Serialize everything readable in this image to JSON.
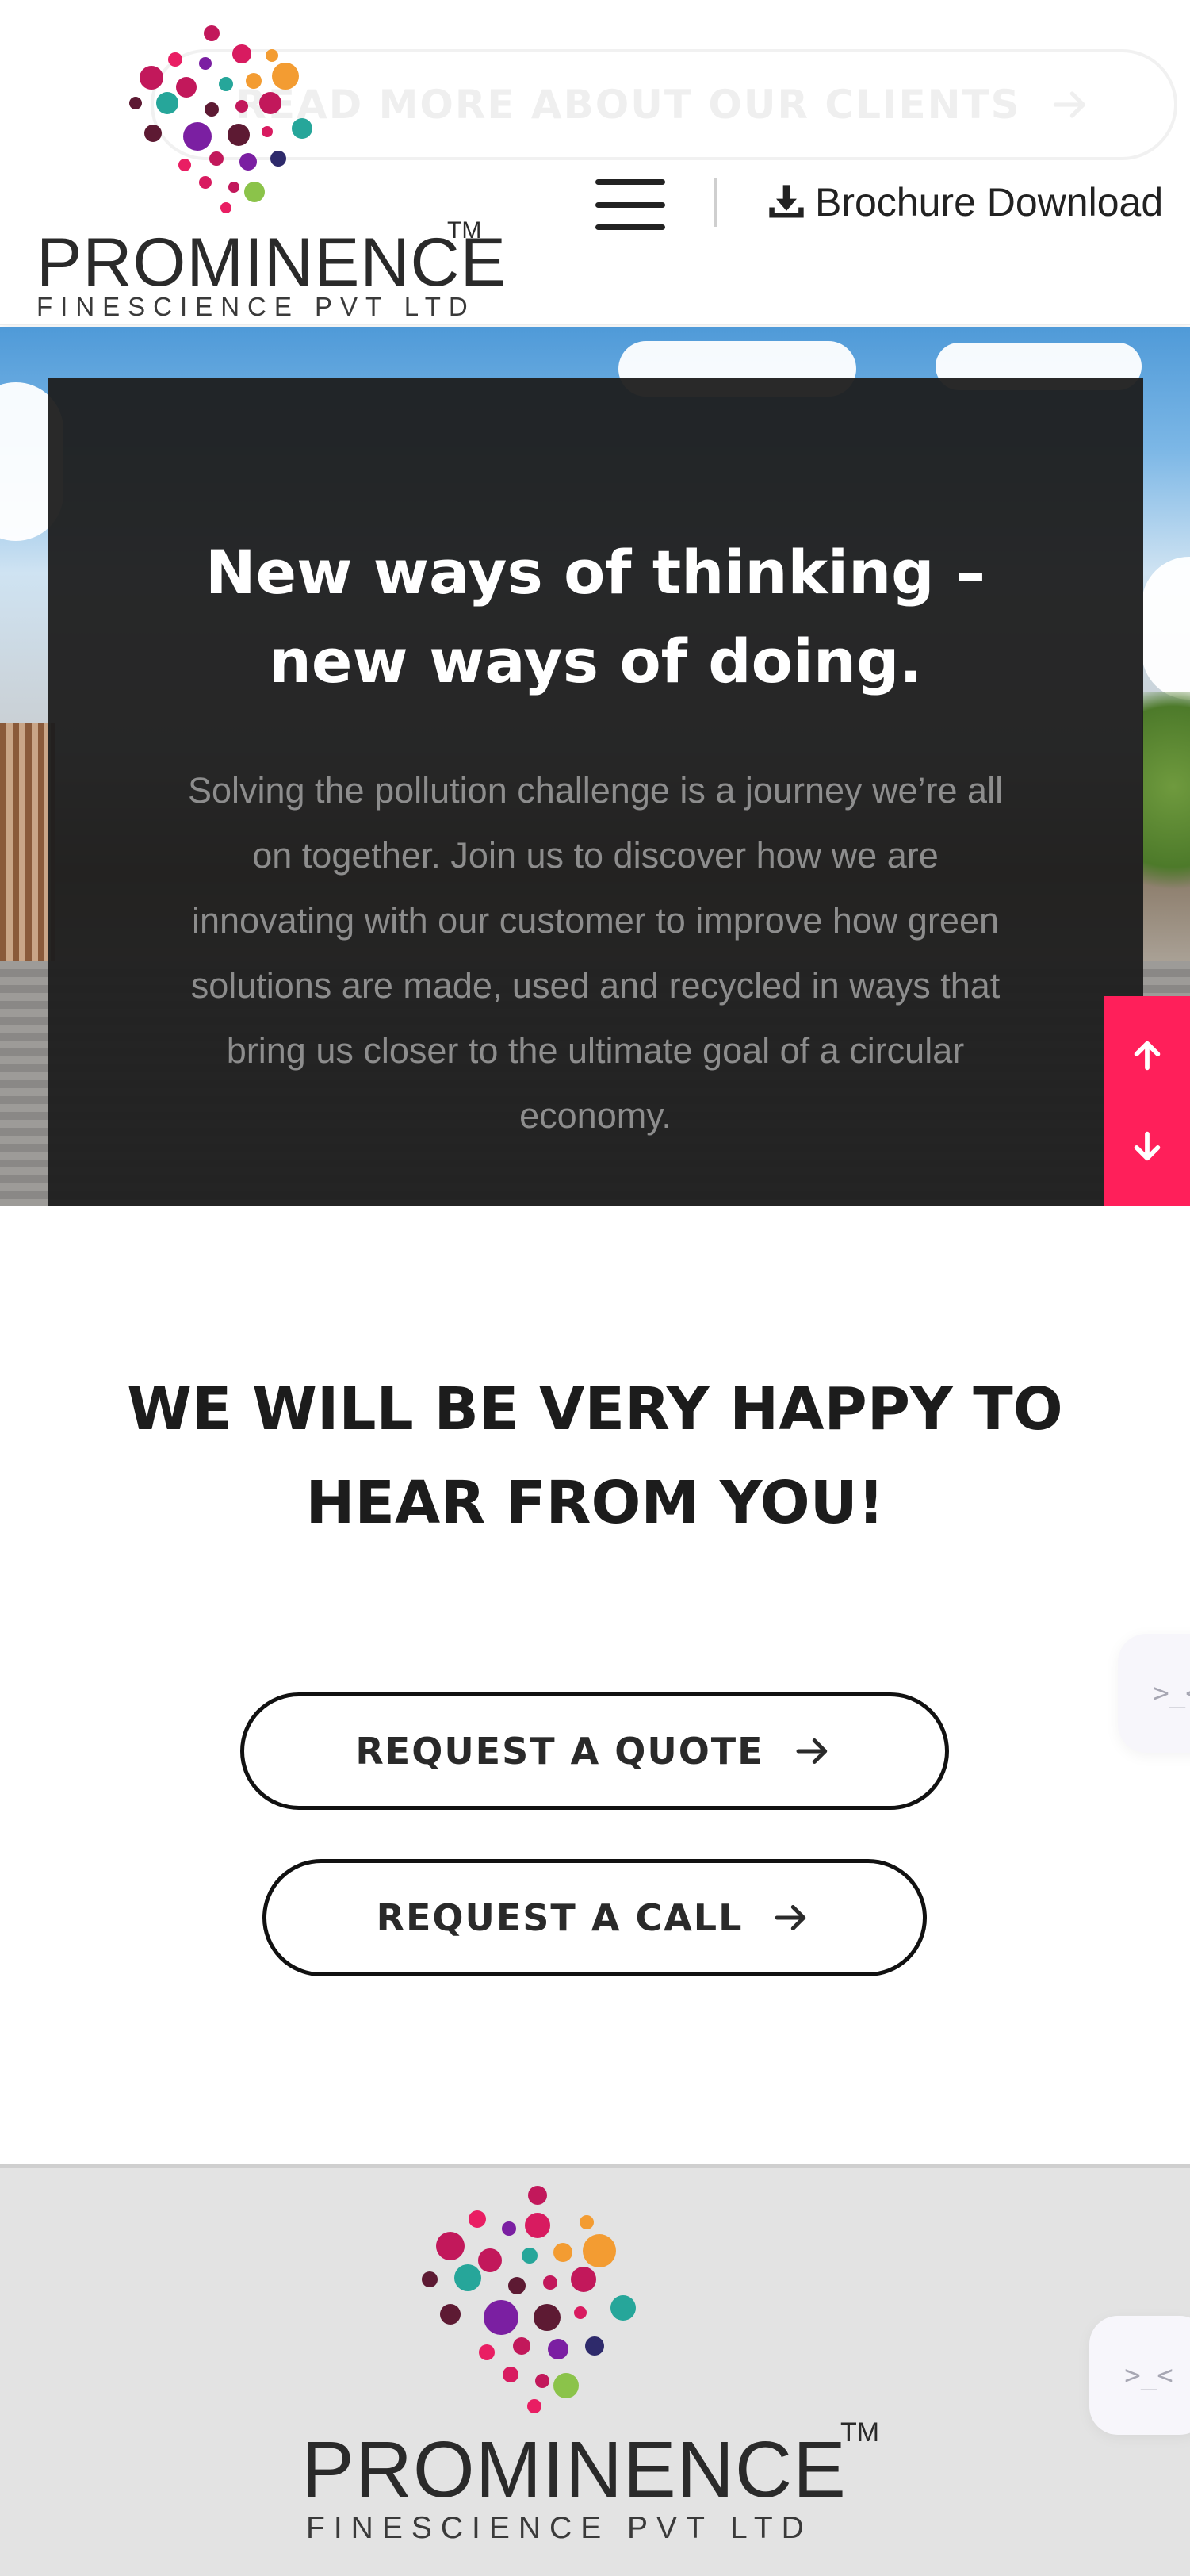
{
  "header": {
    "ghost_button_label": "READ MORE ABOUT OUR CLIENTS",
    "logo_word": "PROMINENCE",
    "logo_tm": "TM",
    "logo_sub": "FINESCIENCE PVT LTD",
    "menu_icon": "hamburger-menu-icon",
    "brochure_icon": "download-icon",
    "brochure_label": "Brochure Download"
  },
  "hero": {
    "title_lines": [
      "New ways of thinking –",
      "new ways of doing."
    ],
    "body_lines": [
      "Solving the pollution challenge is a journey we’re all",
      "on together. Join us to discover how we are",
      "innovating with our customer to improve how green",
      "solutions are made, used and recycled in ways that",
      "bring us closer to the ultimate goal of a circular",
      "economy."
    ],
    "scroll_up_icon": "arrow-up-icon",
    "scroll_down_icon": "arrow-down-icon"
  },
  "cta": {
    "heading_lines": [
      "WE WILL BE VERY HAPPY TO",
      "HEAR FROM YOU!"
    ],
    "quote_label": "REQUEST A QUOTE",
    "call_label": "REQUEST A CALL",
    "arrow_icon": "arrow-right-icon"
  },
  "widgets": {
    "glyph": ">_<"
  },
  "footer": {
    "logo_word": "PROMINENCE",
    "logo_tm": "TM",
    "logo_sub": "FINESCIENCE PVT LTD"
  },
  "colors": {
    "accent": "#ff1f5a",
    "panel": "#1e1e1e",
    "footer_bg": "#e3e3e3",
    "logo_dots": [
      "#c2185b",
      "#e91e63",
      "#7b1fa2",
      "#5d1a33",
      "#26a69a",
      "#f39c32",
      "#8bc34a",
      "#2e2a6b",
      "#d81b60"
    ]
  }
}
